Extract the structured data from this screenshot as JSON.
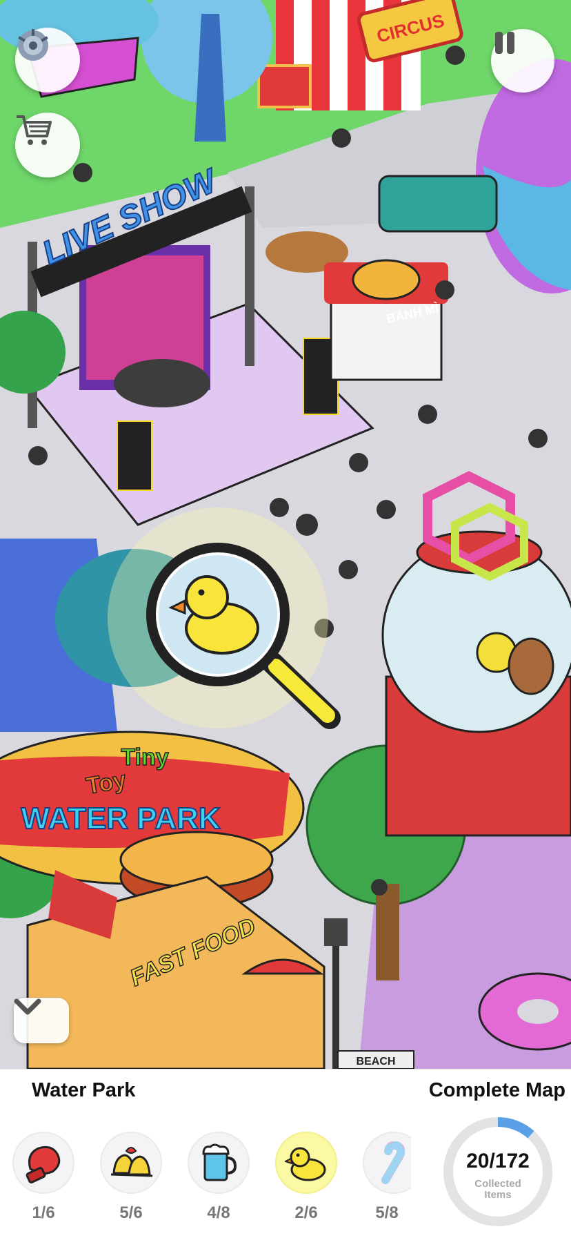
{
  "map": {
    "signs": {
      "circus": "CIRCUS",
      "live_show": "LIVE SHOW",
      "banh_mi": "BÁNH MÌ",
      "water_park_top": "Toy",
      "water_park_mid": "Tiny",
      "water_park": "WATER PARK",
      "fast_food": "FAST FOOD",
      "beach": "BEACH"
    },
    "target_item": "rubber-duck"
  },
  "buttons": {
    "settings_icon": "gear-icon",
    "cart_icon": "cart-icon",
    "pause_icon": "pause-icon",
    "collapse_icon": "chevron-down-icon"
  },
  "panel": {
    "area_title": "Water Park",
    "complete_title": "Complete Map",
    "items": [
      {
        "icon": "boxing-glove-icon",
        "count": "1/6",
        "active": false
      },
      {
        "icon": "bells-icon",
        "count": "5/6",
        "active": false
      },
      {
        "icon": "beer-mug-icon",
        "count": "4/8",
        "active": false
      },
      {
        "icon": "rubber-duck-icon",
        "count": "2/6",
        "active": true
      },
      {
        "icon": "candy-cane-icon",
        "count": "5/8",
        "active": false
      }
    ],
    "progress": {
      "count": "20/172",
      "caption_line1": "Collected",
      "caption_line2": "Items",
      "fraction": 0.116
    }
  },
  "colors": {
    "highlight": "#fbf9a3",
    "magnifier": "#f7e938",
    "duck": "#f9e43c"
  }
}
